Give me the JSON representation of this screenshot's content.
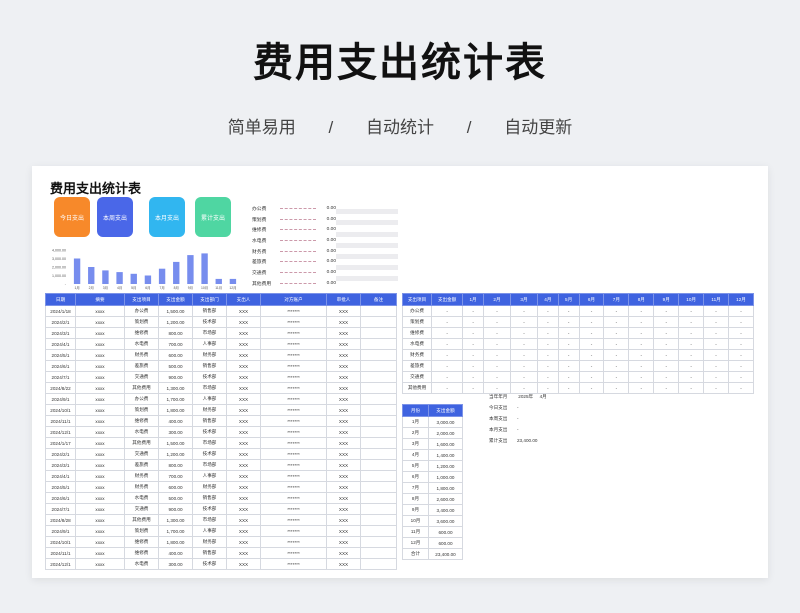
{
  "hero": {
    "title": "费用支出统计表",
    "subtitle_parts": [
      "简单易用",
      "/",
      "自动统计",
      "/",
      "自动更新"
    ]
  },
  "sheet": {
    "title": "费用支出统计表",
    "cards": [
      {
        "label": "今日支出",
        "color": "#f7892a"
      },
      {
        "label": "本周支出",
        "color": "#4a67e8"
      },
      {
        "label": "本月支出",
        "color": "#31b6f0"
      },
      {
        "label": "累计支出",
        "color": "#4fd6a2"
      }
    ],
    "bar_chart": {
      "type": "bar",
      "categories": [
        "1月",
        "2月",
        "3月",
        "4月",
        "5月",
        "6月",
        "7月",
        "8月",
        "9月",
        "10月",
        "11月",
        "12月"
      ],
      "values": [
        3000,
        2000,
        1600,
        1400,
        1200,
        1000,
        1800,
        2600,
        3400,
        3600,
        600,
        600
      ],
      "ytick_labels": [
        "4,000.00",
        "3,000.00",
        "2,000.00",
        "1,000.00",
        "-"
      ],
      "ylim": [
        0,
        4000
      ],
      "color": "#4a67e8"
    },
    "expense_list": [
      {
        "label": "办公费",
        "value": "0.00"
      },
      {
        "label": "策划费",
        "value": "0.00"
      },
      {
        "label": "维修费",
        "value": "0.00"
      },
      {
        "label": "水电费",
        "value": "0.00"
      },
      {
        "label": "财务费",
        "value": "0.00"
      },
      {
        "label": "差旅费",
        "value": "0.00"
      },
      {
        "label": "交通费",
        "value": "0.00"
      },
      {
        "label": "其他费用",
        "value": "0.00"
      }
    ],
    "main_table": {
      "headers": [
        "日期",
        "摘要",
        "支出项目",
        "支出金额",
        "支出部门",
        "支出人",
        "对方账户",
        "审批人",
        "备注"
      ],
      "rows": [
        [
          "2024/1/18",
          "xxxx",
          "办公费",
          "1,500.00",
          "销售部",
          "XXX",
          "*******",
          "XXX",
          ""
        ],
        [
          "2024/2/1",
          "xxxx",
          "策划费",
          "1,200.00",
          "技术部",
          "XXX",
          "*******",
          "XXX",
          ""
        ],
        [
          "2024/3/1",
          "xxxx",
          "维修费",
          "800.00",
          "市场部",
          "XXX",
          "*******",
          "XXX",
          ""
        ],
        [
          "2024/4/1",
          "xxxx",
          "水电费",
          "700.00",
          "人事部",
          "XXX",
          "*******",
          "XXX",
          ""
        ],
        [
          "2024/5/1",
          "xxxx",
          "财务费",
          "600.00",
          "财务部",
          "XXX",
          "*******",
          "XXX",
          ""
        ],
        [
          "2024/6/1",
          "xxxx",
          "差旅费",
          "500.00",
          "销售部",
          "XXX",
          "*******",
          "XXX",
          ""
        ],
        [
          "2024/7/1",
          "xxxx",
          "交通费",
          "900.00",
          "技术部",
          "XXX",
          "*******",
          "XXX",
          ""
        ],
        [
          "2024/8/22",
          "xxxx",
          "其他费用",
          "1,300.00",
          "市场部",
          "XXX",
          "*******",
          "XXX",
          ""
        ],
        [
          "2024/9/1",
          "xxxx",
          "办公费",
          "1,700.00",
          "人事部",
          "XXX",
          "*******",
          "XXX",
          ""
        ],
        [
          "2024/10/1",
          "xxxx",
          "策划费",
          "1,800.00",
          "财务部",
          "XXX",
          "*******",
          "XXX",
          ""
        ],
        [
          "2024/11/1",
          "xxxx",
          "维修费",
          "400.00",
          "销售部",
          "XXX",
          "*******",
          "XXX",
          ""
        ],
        [
          "2024/12/1",
          "xxxx",
          "水电费",
          "300.00",
          "技术部",
          "XXX",
          "*******",
          "XXX",
          ""
        ],
        [
          "2024/1/17",
          "xxxx",
          "其他费用",
          "1,500.00",
          "市场部",
          "XXX",
          "*******",
          "XXX",
          ""
        ],
        [
          "2024/2/1",
          "xxxx",
          "交通费",
          "1,200.00",
          "技术部",
          "XXX",
          "*******",
          "XXX",
          ""
        ],
        [
          "2024/3/1",
          "xxxx",
          "差旅费",
          "800.00",
          "市场部",
          "XXX",
          "*******",
          "XXX",
          ""
        ],
        [
          "2024/4/1",
          "xxxx",
          "财务费",
          "700.00",
          "人事部",
          "XXX",
          "*******",
          "XXX",
          ""
        ],
        [
          "2024/5/1",
          "xxxx",
          "财务费",
          "600.00",
          "财务部",
          "XXX",
          "*******",
          "XXX",
          ""
        ],
        [
          "2024/6/1",
          "xxxx",
          "水电费",
          "500.00",
          "销售部",
          "XXX",
          "*******",
          "XXX",
          ""
        ],
        [
          "2024/7/1",
          "xxxx",
          "交通费",
          "900.00",
          "技术部",
          "XXX",
          "*******",
          "XXX",
          ""
        ],
        [
          "2024/8/28",
          "xxxx",
          "其他费用",
          "1,300.00",
          "市场部",
          "XXX",
          "*******",
          "XXX",
          ""
        ],
        [
          "2024/9/1",
          "xxxx",
          "策划费",
          "1,700.00",
          "人事部",
          "XXX",
          "*******",
          "XXX",
          ""
        ],
        [
          "2024/10/1",
          "xxxx",
          "维修费",
          "1,800.00",
          "财务部",
          "XXX",
          "*******",
          "XXX",
          ""
        ],
        [
          "2024/11/1",
          "xxxx",
          "维修费",
          "400.00",
          "销售部",
          "XXX",
          "*******",
          "XXX",
          ""
        ],
        [
          "2024/12/1",
          "xxxx",
          "水电费",
          "300.00",
          "技术部",
          "XXX",
          "*******",
          "XXX",
          ""
        ]
      ]
    },
    "category_table": {
      "headers": [
        "支出项目",
        "支出金额",
        "1月",
        "2月",
        "3月",
        "4月",
        "5月",
        "6月",
        "7月",
        "8月",
        "9月",
        "10月",
        "11月",
        "12月"
      ],
      "rows": [
        [
          "办公费",
          "-",
          "-",
          "-",
          "-",
          "-",
          "-",
          "-",
          "-",
          "-",
          "-",
          "-",
          "-",
          "-"
        ],
        [
          "策划费",
          "-",
          "-",
          "-",
          "-",
          "-",
          "-",
          "-",
          "-",
          "-",
          "-",
          "-",
          "-",
          "-"
        ],
        [
          "维修费",
          "-",
          "-",
          "-",
          "-",
          "-",
          "-",
          "-",
          "-",
          "-",
          "-",
          "-",
          "-",
          "-"
        ],
        [
          "水电费",
          "-",
          "-",
          "-",
          "-",
          "-",
          "-",
          "-",
          "-",
          "-",
          "-",
          "-",
          "-",
          "-"
        ],
        [
          "财务费",
          "-",
          "-",
          "-",
          "-",
          "-",
          "-",
          "-",
          "-",
          "-",
          "-",
          "-",
          "-",
          "-"
        ],
        [
          "差旅费",
          "-",
          "-",
          "-",
          "-",
          "-",
          "-",
          "-",
          "-",
          "-",
          "-",
          "-",
          "-",
          "-"
        ],
        [
          "交通费",
          "-",
          "-",
          "-",
          "-",
          "-",
          "-",
          "-",
          "-",
          "-",
          "-",
          "-",
          "-",
          "-"
        ],
        [
          "其他费用",
          "-",
          "-",
          "-",
          "-",
          "-",
          "-",
          "-",
          "-",
          "-",
          "-",
          "-",
          "-",
          "-"
        ]
      ]
    },
    "month_table": {
      "headers": [
        "月份",
        "支出金额"
      ],
      "rows": [
        [
          "1月",
          "3,000.00"
        ],
        [
          "2月",
          "2,000.00"
        ],
        [
          "3月",
          "1,600.00"
        ],
        [
          "4月",
          "1,400.00"
        ],
        [
          "5月",
          "1,200.00"
        ],
        [
          "6月",
          "1,000.00"
        ],
        [
          "7月",
          "1,800.00"
        ],
        [
          "8月",
          "2,600.00"
        ],
        [
          "9月",
          "3,400.00"
        ],
        [
          "10月",
          "3,600.00"
        ],
        [
          "11月",
          "600.00"
        ],
        [
          "12月",
          "600.00"
        ],
        [
          "合计",
          "23,400.00"
        ]
      ]
    },
    "summary": {
      "current_label": "当年年月",
      "current_year": "2025年",
      "current_month": "4月",
      "items": [
        {
          "label": "今日支出",
          "value": "-"
        },
        {
          "label": "本周支出",
          "value": "-"
        },
        {
          "label": "本月支出",
          "value": "-"
        },
        {
          "label": "累计支出",
          "value": "23,400.00"
        }
      ]
    }
  }
}
